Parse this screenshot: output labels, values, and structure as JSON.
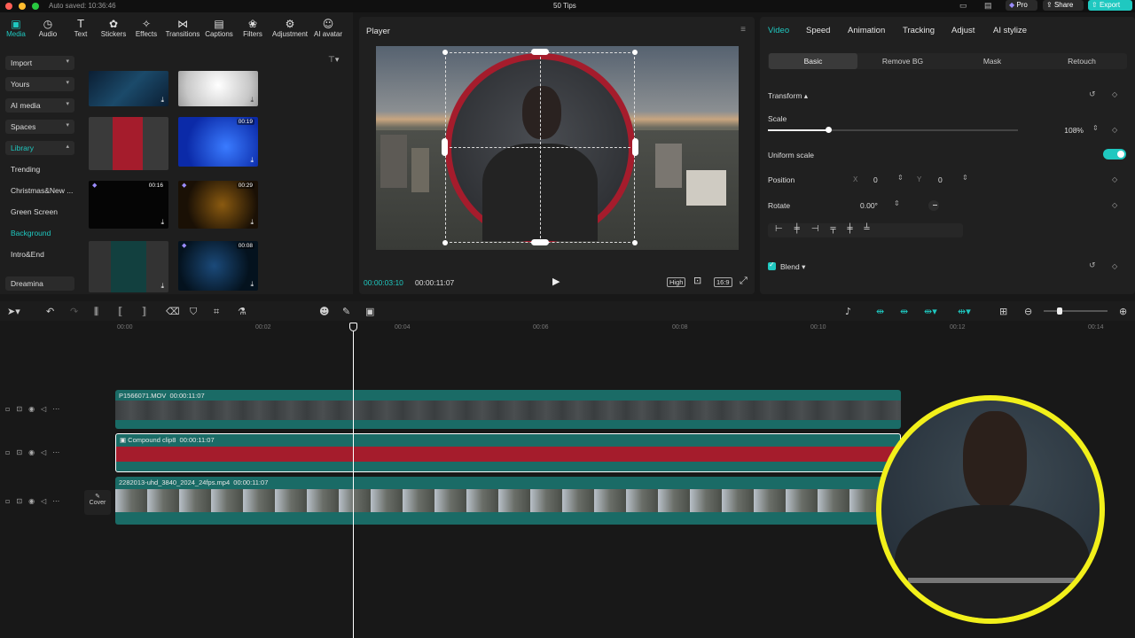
{
  "titlebar": {
    "autosave": "Auto saved: 10:36:46",
    "project": "50 Tips",
    "pro": "Pro",
    "share": "Share",
    "export": "Export"
  },
  "toolbar": [
    {
      "label": "Media",
      "icon": "▣"
    },
    {
      "label": "Audio",
      "icon": "◷"
    },
    {
      "label": "Text",
      "icon": "T"
    },
    {
      "label": "Stickers",
      "icon": "✿"
    },
    {
      "label": "Effects",
      "icon": "✧"
    },
    {
      "label": "Transitions",
      "icon": "⋈"
    },
    {
      "label": "Captions",
      "icon": "▤"
    },
    {
      "label": "Filters",
      "icon": "❀"
    },
    {
      "label": "Adjustment",
      "icon": "⚙"
    },
    {
      "label": "AI avatar",
      "icon": "☺"
    }
  ],
  "categories": {
    "import": "Import",
    "yours": "Yours",
    "ai_media": "AI media",
    "spaces": "Spaces",
    "library": "Library",
    "trending": "Trending",
    "christmas": "Christmas&New ...",
    "green_screen": "Green Screen",
    "background": "Background",
    "intro_end": "Intro&End",
    "dreamina": "Dreamina"
  },
  "media_thumbs": [
    {
      "duration": ""
    },
    {
      "duration": ""
    },
    {
      "duration": ""
    },
    {
      "duration": "00:19"
    },
    {
      "duration": "00:16"
    },
    {
      "duration": "00:29"
    },
    {
      "duration": ""
    },
    {
      "duration": "00:08"
    }
  ],
  "player": {
    "title": "Player",
    "current": "00:00:03:10",
    "total": "00:00:11:07",
    "quality": "High",
    "ratio": "16:9"
  },
  "right": {
    "tabs": [
      "Video",
      "Speed",
      "Animation",
      "Tracking",
      "Adjust",
      "AI stylize"
    ],
    "subtabs": [
      "Basic",
      "Remove BG",
      "Mask",
      "Retouch"
    ],
    "transform": "Transform",
    "scale_label": "Scale",
    "scale_value": "108%",
    "scale_fraction": 0.108,
    "uniform": "Uniform scale",
    "position": "Position",
    "x_label": "X",
    "x_value": "0",
    "y_label": "Y",
    "y_value": "0",
    "rotate": "Rotate",
    "rotate_value": "0.00°",
    "blend": "Blend"
  },
  "ruler": [
    "00:00",
    "00:02",
    "00:04",
    "00:06",
    "00:08",
    "00:10",
    "00:12",
    "00:14"
  ],
  "tracks": {
    "clip1": "P1566071.MOV",
    "clip1_dur": "00:00:11:07",
    "clip2": "Compound clip8",
    "clip2_dur": "00:00:11:07",
    "clip3": "2282013-uhd_3840_2024_24fps.mp4",
    "clip3_dur": "00:00:11:07",
    "cover": "Cover"
  },
  "colors": {
    "accent": "#1fc8c0",
    "clip_teal": "#1a6b66",
    "red": "#a51c2c",
    "yellow_ring": "#f2f01a"
  }
}
